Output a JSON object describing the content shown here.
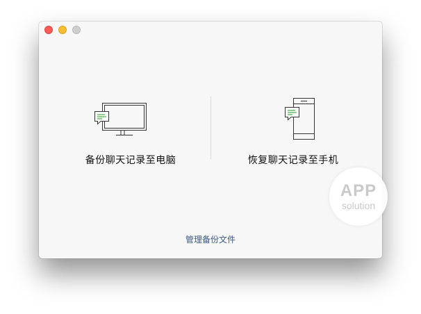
{
  "window": {
    "controls": [
      "close",
      "minimize",
      "zoom"
    ]
  },
  "options": {
    "backup": {
      "label": "备份聊天记录至电脑",
      "icon": "monitor-chat-icon"
    },
    "restore": {
      "label": "恢复聊天记录至手机",
      "icon": "phone-chat-icon"
    }
  },
  "footer": {
    "manage_label": "管理备份文件"
  },
  "watermark": {
    "line1": "APP",
    "line2": "solution"
  },
  "colors": {
    "accent_green": "#5cb85c",
    "link_blue": "#3d5a86",
    "close": "#fc5b57",
    "minimize": "#f6bf31",
    "zoom": "#cfcfcf"
  }
}
